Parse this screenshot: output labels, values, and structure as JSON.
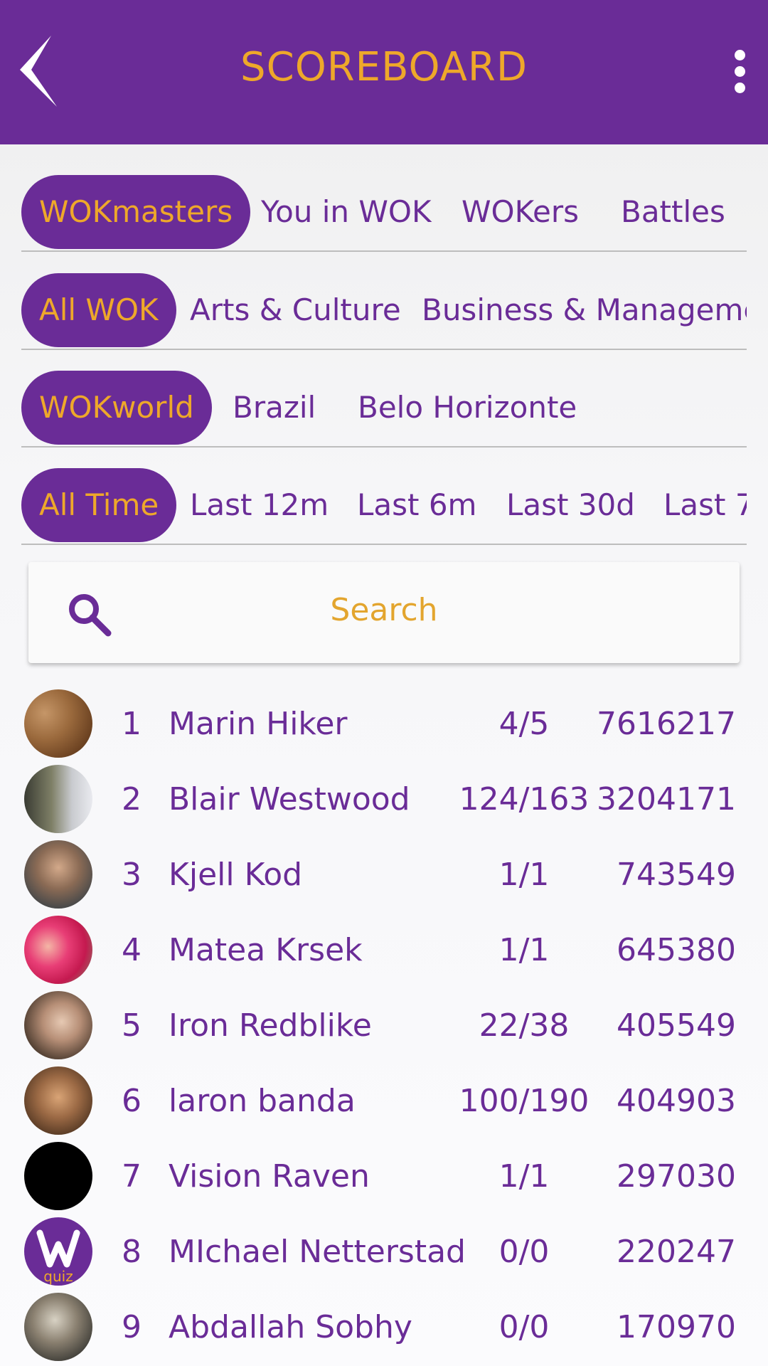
{
  "appbar": {
    "title": "SCOREBOARD"
  },
  "tab_rows": [
    {
      "tabs": [
        "WOKmasters",
        "You in WOK",
        "WOKers",
        "Battles"
      ],
      "active": 0
    },
    {
      "tabs": [
        "All WOK",
        "Arts & Culture",
        "Business & Manageme"
      ],
      "active": 0
    },
    {
      "tabs": [
        "WOKworld",
        "Brazil",
        "Belo Horizonte"
      ],
      "active": 0
    },
    {
      "tabs": [
        "All Time",
        "Last 12m",
        "Last 6m",
        "Last 30d",
        "Last 7"
      ],
      "active": 0
    }
  ],
  "search": {
    "placeholder": "Search"
  },
  "leaders": [
    {
      "rank": "1",
      "name": "Marin Hiker",
      "ratio": "4/5",
      "score": "7616217"
    },
    {
      "rank": "2",
      "name": "Blair Westwood",
      "ratio": "124/163",
      "score": "3204171"
    },
    {
      "rank": "3",
      "name": "Kjell Kod",
      "ratio": "1/1",
      "score": "743549"
    },
    {
      "rank": "4",
      "name": "Matea Krsek",
      "ratio": "1/1",
      "score": "645380"
    },
    {
      "rank": "5",
      "name": "Iron Redblike",
      "ratio": "22/38",
      "score": "405549"
    },
    {
      "rank": "6",
      "name": "laron banda",
      "ratio": "100/190",
      "score": "404903"
    },
    {
      "rank": "7",
      "name": "Vision Raven",
      "ratio": "1/1",
      "score": "297030"
    },
    {
      "rank": "8",
      "name": "MIchael Netterstad",
      "ratio": "0/0",
      "score": "220247"
    },
    {
      "rank": "9",
      "name": "Abdallah Sobhy",
      "ratio": "0/0",
      "score": "170970"
    }
  ],
  "avatar_logo_text": "quiz",
  "colors": {
    "primary": "#6a2c97",
    "accent": "#eea82a",
    "background": "#f4f4f6"
  }
}
